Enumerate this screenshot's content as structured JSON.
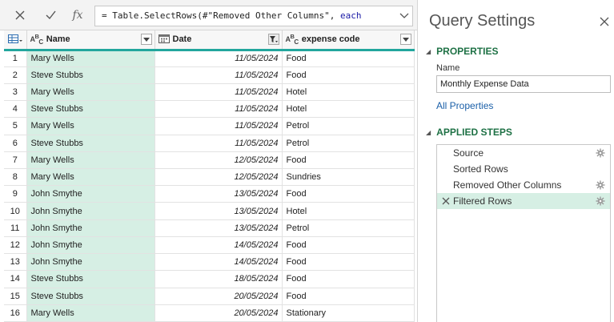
{
  "formula": {
    "prefix": "= Table.SelectRows(#\"Removed Other Columns\", ",
    "keyword": "each"
  },
  "columns": [
    {
      "name": "Name",
      "type_badge": "ABC"
    },
    {
      "name": "Date",
      "type_badge": "calendar"
    },
    {
      "name": "expense code",
      "type_badge": "ABC"
    }
  ],
  "rows": [
    {
      "index": "1",
      "name": "Mary Wells",
      "date": "11/05/2024",
      "code": "Food"
    },
    {
      "index": "2",
      "name": "Steve Stubbs",
      "date": "11/05/2024",
      "code": "Food"
    },
    {
      "index": "3",
      "name": "Mary Wells",
      "date": "11/05/2024",
      "code": "Hotel"
    },
    {
      "index": "4",
      "name": "Steve Stubbs",
      "date": "11/05/2024",
      "code": "Hotel"
    },
    {
      "index": "5",
      "name": "Mary Wells",
      "date": "11/05/2024",
      "code": "Petrol"
    },
    {
      "index": "6",
      "name": "Steve Stubbs",
      "date": "11/05/2024",
      "code": "Petrol"
    },
    {
      "index": "7",
      "name": "Mary Wells",
      "date": "12/05/2024",
      "code": "Food"
    },
    {
      "index": "8",
      "name": "Mary Wells",
      "date": "12/05/2024",
      "code": "Sundries"
    },
    {
      "index": "9",
      "name": "John Smythe",
      "date": "13/05/2024",
      "code": "Food"
    },
    {
      "index": "10",
      "name": "John Smythe",
      "date": "13/05/2024",
      "code": "Hotel"
    },
    {
      "index": "11",
      "name": "John Smythe",
      "date": "13/05/2024",
      "code": "Petrol"
    },
    {
      "index": "12",
      "name": "John Smythe",
      "date": "14/05/2024",
      "code": "Food"
    },
    {
      "index": "13",
      "name": "John Smythe",
      "date": "14/05/2024",
      "code": "Food"
    },
    {
      "index": "14",
      "name": "Steve Stubbs",
      "date": "18/05/2024",
      "code": "Food"
    },
    {
      "index": "15",
      "name": "Steve Stubbs",
      "date": "20/05/2024",
      "code": "Food"
    },
    {
      "index": "16",
      "name": "Mary Wells",
      "date": "20/05/2024",
      "code": "Stationary"
    }
  ],
  "settings": {
    "title": "Query Settings",
    "properties_label": "PROPERTIES",
    "name_label": "Name",
    "name_value": "Monthly Expense Data",
    "all_properties": "All Properties",
    "applied_steps_label": "APPLIED STEPS",
    "steps": [
      {
        "label": "Source",
        "has_gear": true,
        "selected": false
      },
      {
        "label": "Sorted Rows",
        "has_gear": false,
        "selected": false
      },
      {
        "label": "Removed Other Columns",
        "has_gear": true,
        "selected": false
      },
      {
        "label": "Filtered Rows",
        "has_gear": true,
        "selected": true
      }
    ]
  },
  "colors": {
    "accent": "#22a69d",
    "selected_bg": "#d6efe4",
    "section_green": "#1e7145",
    "link": "#1a5fa8"
  }
}
